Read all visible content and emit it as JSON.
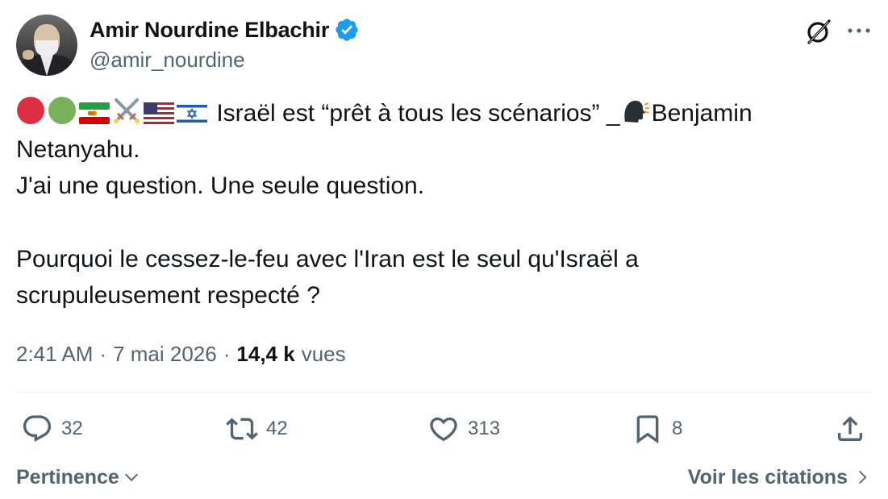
{
  "author": {
    "display_name": "Amir Nourdine Elbachir",
    "handle": "@amir_nourdine",
    "verified": true,
    "verified_color": "#1d9bf0"
  },
  "tweet": {
    "line1_text": "Israël est “prêt à tous les scénarios” _",
    "line1_after_emoji": "Benjamin",
    "line2": "Netanyahu.",
    "line3": "J'ai une question. Une seule question.",
    "line4": "Pourquoi le cessez-le-feu avec l'Iran est le seul qu'Israël a",
    "line5": "scrupuleusement respecté ?",
    "emojis": [
      "red-circle",
      "green-circle",
      "iran-lion-sun-flag",
      "crossed-swords",
      "us-flag",
      "israel-flag",
      "speaking-head"
    ]
  },
  "meta": {
    "time": "2:41 AM",
    "sep1": "·",
    "date": "7 mai 2026",
    "sep2": "·",
    "views_count": "14,4 k",
    "views_label": "vues"
  },
  "actions": {
    "replies": "32",
    "reposts": "42",
    "likes": "313",
    "bookmarks": "8"
  },
  "footer": {
    "sort_label": "Pertinence",
    "quotes_label": "Voir les citations"
  },
  "colors": {
    "text": "#0f1419",
    "secondary": "#536471",
    "divider": "#eff3f4",
    "accent": "#1d9bf0"
  }
}
